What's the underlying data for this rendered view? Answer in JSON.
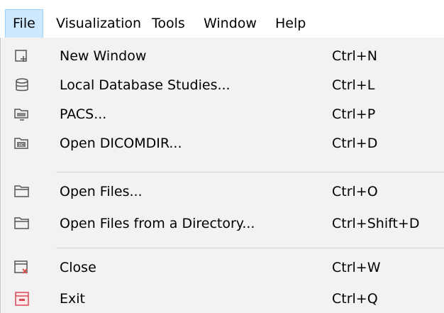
{
  "menubar": {
    "items": [
      {
        "label": "File"
      },
      {
        "label": "Visualization"
      },
      {
        "label": "Tools"
      },
      {
        "label": "Window"
      },
      {
        "label": "Help"
      }
    ]
  },
  "file_menu": {
    "items": [
      {
        "label": "New Window",
        "shortcut": "Ctrl+N",
        "icon": "new-window-icon"
      },
      {
        "label": "Local Database Studies...",
        "shortcut": "Ctrl+L",
        "icon": "database-icon"
      },
      {
        "label": "PACS...",
        "shortcut": "Ctrl+P",
        "icon": "pacs-icon"
      },
      {
        "label": "Open DICOMDIR...",
        "shortcut": "Ctrl+D",
        "icon": "dicomdir-icon"
      },
      {
        "label": "Open Files...",
        "shortcut": "Ctrl+O",
        "icon": "folder-icon"
      },
      {
        "label": "Open Files from a Directory...",
        "shortcut": "Ctrl+Shift+D",
        "icon": "folder-icon"
      },
      {
        "label": "Close",
        "shortcut": "Ctrl+W",
        "icon": "close-window-icon"
      },
      {
        "label": "Exit",
        "shortcut": "Ctrl+Q",
        "icon": "exit-icon"
      }
    ]
  },
  "colors": {
    "active_menu_bg": "#cce8ff",
    "active_menu_border": "#99d1ff",
    "dropdown_bg": "#f2f2f2",
    "close_icon_accent": "#d9534f",
    "exit_icon_accent": "#d9485a"
  }
}
